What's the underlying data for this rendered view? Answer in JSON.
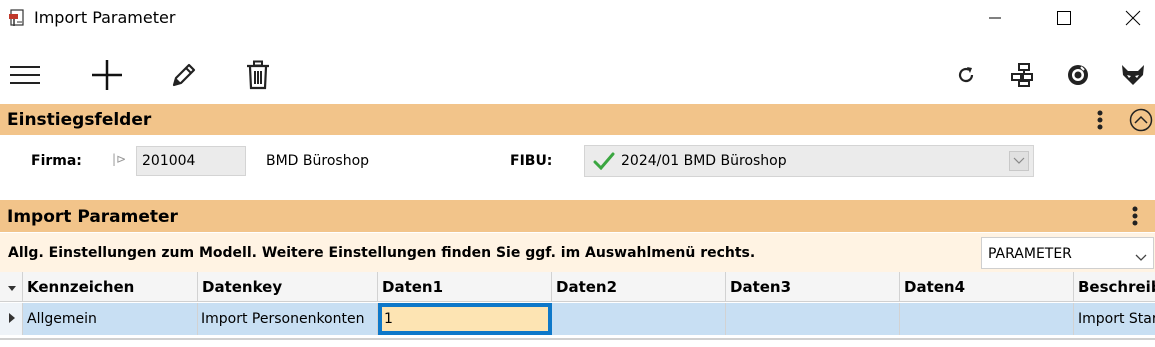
{
  "window": {
    "title": "Import Parameter"
  },
  "sections": {
    "entry": {
      "title": "Einstiegsfelder",
      "firma_label": "Firma:",
      "firma_value": "201004",
      "firma_name": "BMD Büroshop",
      "fibu_label": "FIBU:",
      "fibu_value": "2024/01 BMD Büroshop"
    },
    "import": {
      "title": "Import Parameter",
      "info": "Allg. Einstellungen zum Modell. Weitere Einstellungen finden Sie ggf. im Auswahlmenü rechts.",
      "dropdown_value": "PARAMETER"
    }
  },
  "grid": {
    "columns": [
      "Kennzeichen",
      "Datenkey",
      "Daten1",
      "Daten2",
      "Daten3",
      "Daten4",
      "Beschreib"
    ],
    "rows": [
      [
        "Allgemein",
        "Import Personenkonten",
        "1",
        "",
        "",
        "",
        "Import Star"
      ]
    ]
  },
  "colors": {
    "section_header": "#f2c48a",
    "info_bar": "#fff3e3",
    "selected_row": "#c8dff3",
    "active_cell_border": "#0e78c9",
    "active_cell_fill": "#fde4b3",
    "check_green": "#3aa640"
  },
  "icons": {
    "toolbar_left": [
      "menu-icon",
      "add-icon",
      "edit-icon",
      "delete-icon"
    ],
    "toolbar_right": [
      "refresh-icon",
      "sitemap-icon",
      "help-icon",
      "fox-icon"
    ]
  }
}
